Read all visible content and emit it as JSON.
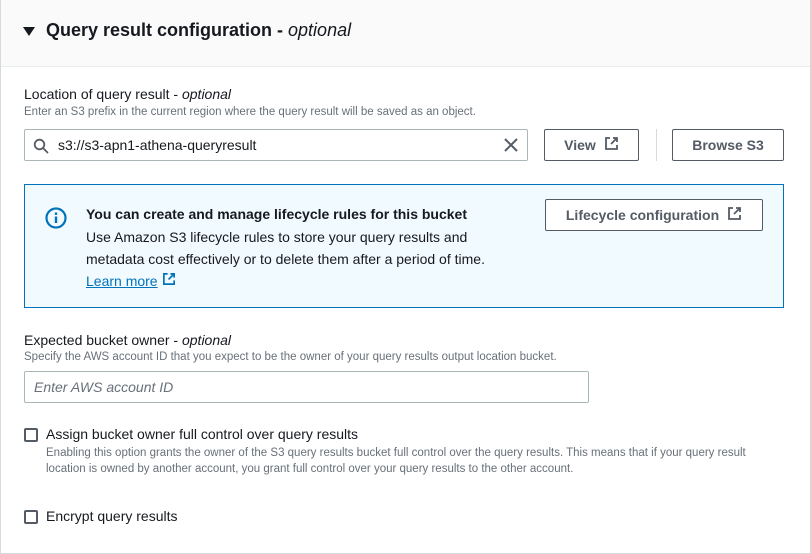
{
  "section": {
    "title": "Query result configuration - ",
    "title_optional": "optional"
  },
  "location": {
    "label": "Location of query result - ",
    "label_optional": "optional",
    "description": "Enter an S3 prefix in the current region where the query result will be saved as an object.",
    "value": "s3://s3-apn1-athena-queryresult",
    "view_label": "View",
    "browse_label": "Browse S3"
  },
  "info": {
    "title": "You can create and manage lifecycle rules for this bucket",
    "line1": "Use Amazon S3 lifecycle rules to store your query results and",
    "line2": "metadata cost effectively or to delete them after a period of time.",
    "link": "Learn more",
    "button": "Lifecycle configuration"
  },
  "owner": {
    "label": "Expected bucket owner - ",
    "label_optional": "optional",
    "description": "Specify the AWS account ID that you expect to be the owner of your query results output location bucket.",
    "placeholder": "Enter AWS account ID"
  },
  "full_control": {
    "label": "Assign bucket owner full control over query results",
    "description": "Enabling this option grants the owner of the S3 query results bucket full control over the query results. This means that if your query result location is owned by another account, you grant full control over your query results to the other account.",
    "checked": false
  },
  "encrypt": {
    "label": "Encrypt query results",
    "checked": false
  },
  "colors": {
    "link": "#0073bb",
    "info_bg": "#f1faff",
    "info_border": "#0073bb",
    "text": "#16191f",
    "secondary_text": "#687078"
  }
}
